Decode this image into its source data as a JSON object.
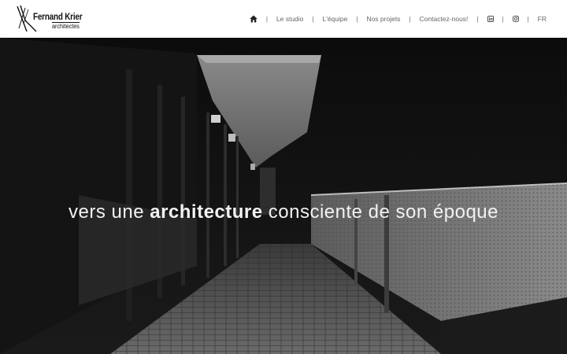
{
  "brand": {
    "name": "Fernand Krier",
    "subtitle": "architectes"
  },
  "nav": {
    "items": [
      {
        "label": "Le studio"
      },
      {
        "label": "L'équipe"
      },
      {
        "label": "Nos projets"
      },
      {
        "label": "Contactez-nous!"
      }
    ],
    "separator": "|",
    "language": "FR",
    "icons": [
      "home-icon",
      "linkedin-icon",
      "instagram-icon"
    ]
  },
  "hero": {
    "tagline_before": "vers une ",
    "tagline_bold": "architecture",
    "tagline_after": " consciente de son époque"
  },
  "colors": {
    "header_bg": "#ffffff",
    "nav_text": "#666666",
    "hero_text": "#f2f2f2"
  }
}
